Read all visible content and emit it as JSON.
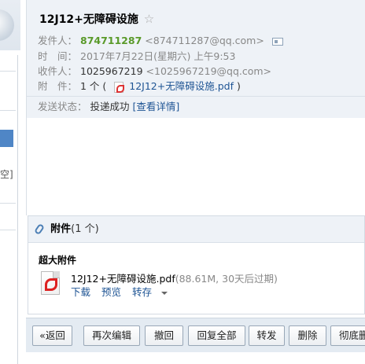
{
  "left": {
    "partial_text": "空]"
  },
  "email": {
    "subject": "12J12+无障碍设施",
    "labels": {
      "from": "发件人：",
      "time": "时　间：",
      "to": "收件人：",
      "attach": "附　件："
    },
    "from_name": "874711287",
    "from_addr": "<874711287@qq.com>",
    "time": "2017年7月22日(星期六) 上午9:53",
    "to_name": "1025967219",
    "to_addr": "<1025967219@qq.com>",
    "attach_count": "1 个 (",
    "attach_name": "12J12+无障碍设施.pdf",
    "attach_close": ")",
    "status_label": "发送状态：",
    "status_value": "投递成功",
    "status_link": "[查看详情]"
  },
  "attachments": {
    "title": "附件",
    "count": "(1 个)",
    "section": "超大附件",
    "file_name": "12J12+无障碍设施.pdf",
    "file_meta": "(88.61M, 30天后过期)",
    "actions": {
      "download": "下载",
      "preview": "预览",
      "save": "转存"
    }
  },
  "toolbar": {
    "back": "«返回",
    "reedit": "再次编辑",
    "recall": "撤回",
    "reply_all": "回复全部",
    "forward": "转发",
    "delete": "删除",
    "delete_perm": "彻底删除"
  },
  "icons": [
    "star-icon",
    "contact-card-icon",
    "pdf-icon",
    "paperclip-icon",
    "caret-down-icon"
  ]
}
